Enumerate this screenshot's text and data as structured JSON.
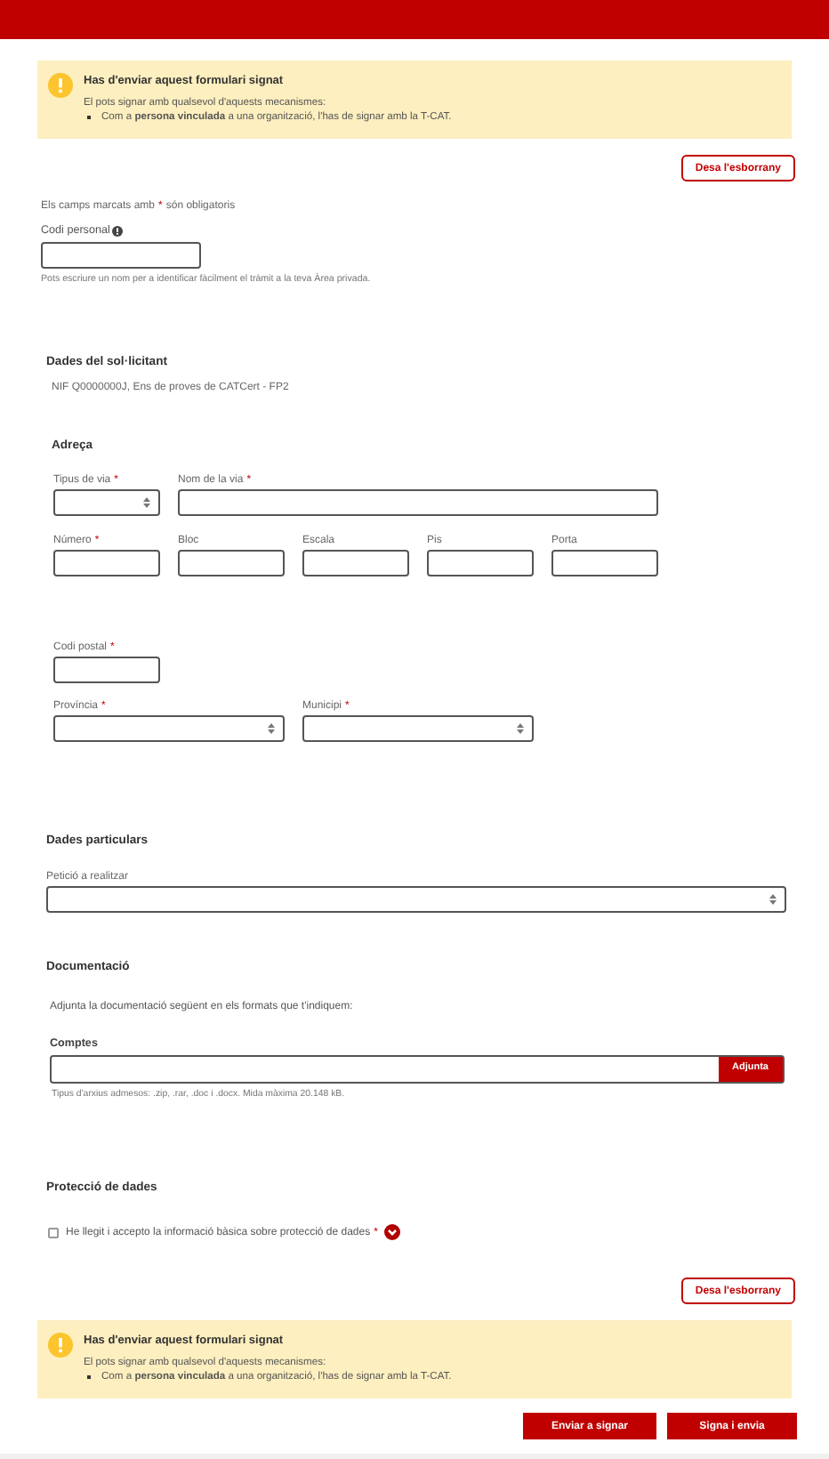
{
  "alert_top": {
    "title": "Has d'enviar aquest formulari signat",
    "intro": "El pots signar amb qualsevol d'aquests mecanismes:",
    "bullets": [
      "Com a **persona vinculada** a una organització, l'has de signar amb la T-CAT."
    ]
  },
  "save_draft_top": "Desa l'esborrany",
  "required_note": {
    "before": "Els camps marcats amb",
    "marker": "*",
    "after": "són obligatoris"
  },
  "personal_code": {
    "label": "Codi personal",
    "hint": "Pots escriure un nom per a identificar fàcilment el tràmit a la teva Àrea privada."
  },
  "applicant": {
    "heading": "Dades del sol·licitant",
    "value": "NIF Q0000000J, Ens de proves de CATCert - FP2"
  },
  "address": {
    "heading": "Adreça",
    "fields": [
      {
        "label": "Tipus de via",
        "marker": "*",
        "kind": "select"
      },
      {
        "label": "Nom de la via",
        "marker": "*",
        "kind": "text"
      },
      {
        "label": "Número",
        "marker": "*",
        "kind": "text"
      },
      {
        "label": "Bloc",
        "kind": "text"
      },
      {
        "label": "Escala",
        "kind": "text"
      },
      {
        "label": "Pis",
        "kind": "text"
      },
      {
        "label": "Porta",
        "kind": "text"
      },
      {
        "label": "Codi postal",
        "marker": "*",
        "kind": "text"
      },
      {
        "label": "Província",
        "marker": "*",
        "kind": "select"
      },
      {
        "label": "Municipi",
        "marker": "*",
        "kind": "select"
      }
    ]
  },
  "particulars": {
    "heading": "Dades particulars",
    "field": {
      "label": "Petició a realitzar",
      "kind": "select"
    }
  },
  "documentation": {
    "heading": "Documentació",
    "intro": "Adjunta la documentació següent en els formats que t'indiquem:",
    "label": "Comptes",
    "button": "Adjunta",
    "hint": "Tipus d'arxius admesos: .zip, .rar, .doc i .docx. Mida màxima 20.148 kB."
  },
  "data_protection": {
    "heading": "Protecció de dades",
    "consent": "He llegit i accepto la informació bàsica sobre protecció de dades",
    "marker": "*",
    "checked": false
  },
  "save_draft_bottom": "Desa l'esborrany",
  "alert_bottom": {
    "title": "Has d'enviar aquest formulari signat",
    "intro": "El pots signar amb qualsevol d'aquests mecanismes:",
    "bullets": [
      "Com a **persona vinculada** a una organització, l'has de signar amb la T-CAT."
    ]
  },
  "actions": [
    "Enviar a signar",
    "Signa i envia"
  ]
}
